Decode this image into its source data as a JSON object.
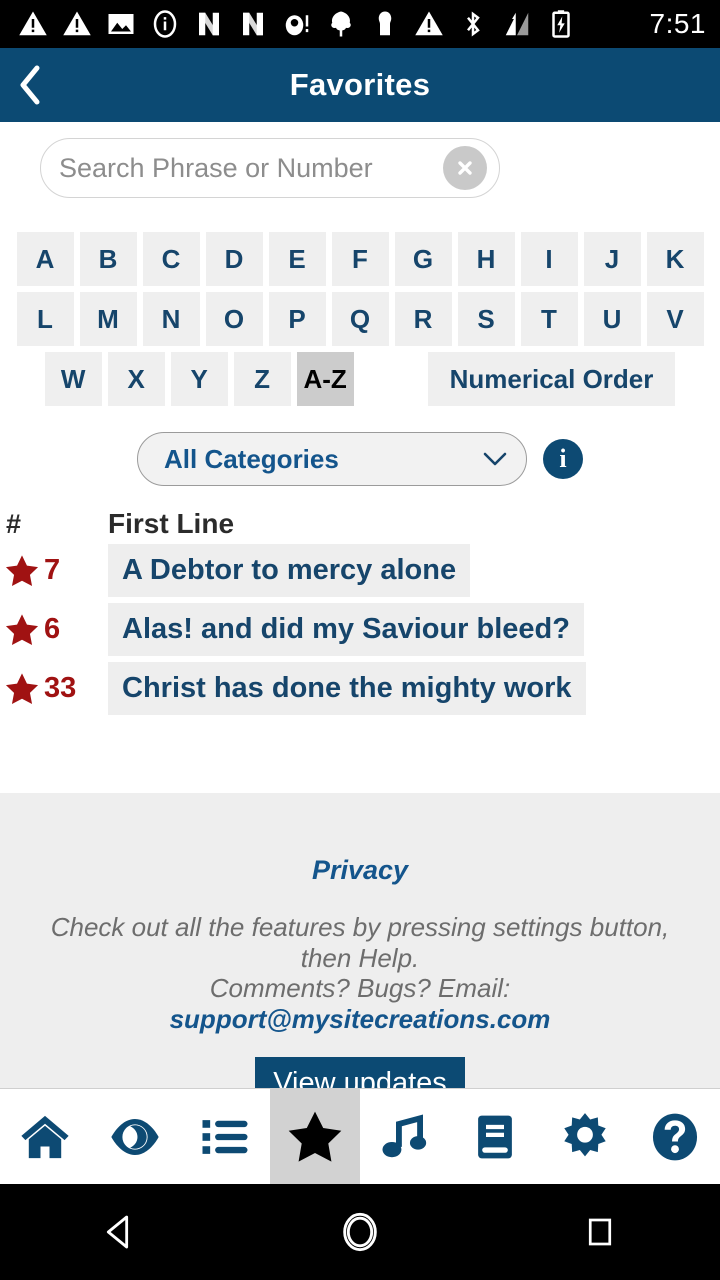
{
  "statusbar": {
    "time": "7:51",
    "icons": [
      "warning-triangle-icon",
      "warning-triangle-icon",
      "image-icon",
      "info-circle-icon",
      "n-app-icon",
      "n-app-icon",
      "alert-dot-icon",
      "tree-icon",
      "person-icon",
      "warning-triangle-icon",
      "bluetooth-icon",
      "signal-icon",
      "battery-charging-icon"
    ]
  },
  "appbar": {
    "title": "Favorites",
    "back_icon": "chevron-left-icon"
  },
  "search": {
    "value": "",
    "placeholder": "Search Phrase or Number",
    "clear_icon": "clear-circle-icon"
  },
  "alphabet": {
    "row1": [
      "A",
      "B",
      "C",
      "D",
      "E",
      "F",
      "G",
      "H",
      "I",
      "J",
      "K"
    ],
    "row2": [
      "L",
      "M",
      "N",
      "O",
      "P",
      "Q",
      "R",
      "S",
      "T",
      "U",
      "V"
    ],
    "row3": [
      "W",
      "X",
      "Y",
      "Z"
    ],
    "sort_az": "A-Z",
    "sort_numerical": "Numerical Order",
    "active_sort": "A-Z"
  },
  "category": {
    "selected": "All Categories",
    "chevron_icon": "chevron-down-icon",
    "info_icon": "info-icon",
    "info_glyph": "i"
  },
  "list": {
    "header_num": "#",
    "header_line": "First Line",
    "rows": [
      {
        "star_icon": "star-filled-icon",
        "number": "7",
        "first_line": "A Debtor to mercy alone"
      },
      {
        "star_icon": "star-filled-icon",
        "number": "6",
        "first_line": "Alas! and did my Saviour bleed?"
      },
      {
        "star_icon": "star-filled-icon",
        "number": "33",
        "first_line": "Christ has done the mighty work"
      }
    ]
  },
  "footer": {
    "privacy": "Privacy",
    "message_line1": "Check out all the features by pressing settings button,",
    "message_line2": "then Help.",
    "message_line3": "Comments? Bugs? Email: ",
    "email": "support@mysitecreations.com",
    "updates_button": "View updates"
  },
  "bottomnav": {
    "items": [
      {
        "name": "home",
        "icon": "home-icon",
        "active": false
      },
      {
        "name": "view",
        "icon": "eye-icon",
        "active": false
      },
      {
        "name": "index",
        "icon": "list-icon",
        "active": false
      },
      {
        "name": "favorites",
        "icon": "star-icon",
        "active": true
      },
      {
        "name": "music",
        "icon": "music-icon",
        "active": false
      },
      {
        "name": "book",
        "icon": "book-icon",
        "active": false
      },
      {
        "name": "settings",
        "icon": "gear-icon",
        "active": false
      },
      {
        "name": "help",
        "icon": "question-icon",
        "active": false
      }
    ]
  },
  "androidnav": {
    "back": "back-triangle-icon",
    "home": "home-circle-icon",
    "recents": "recents-square-icon"
  },
  "colors": {
    "header_blue": "#0c4a73",
    "link_blue": "#14558c",
    "text_navy": "#16456b",
    "star_red": "#a01212",
    "key_bg": "#efefef",
    "key_active_bg": "#cccccc",
    "footer_bg": "#eeeeee"
  }
}
